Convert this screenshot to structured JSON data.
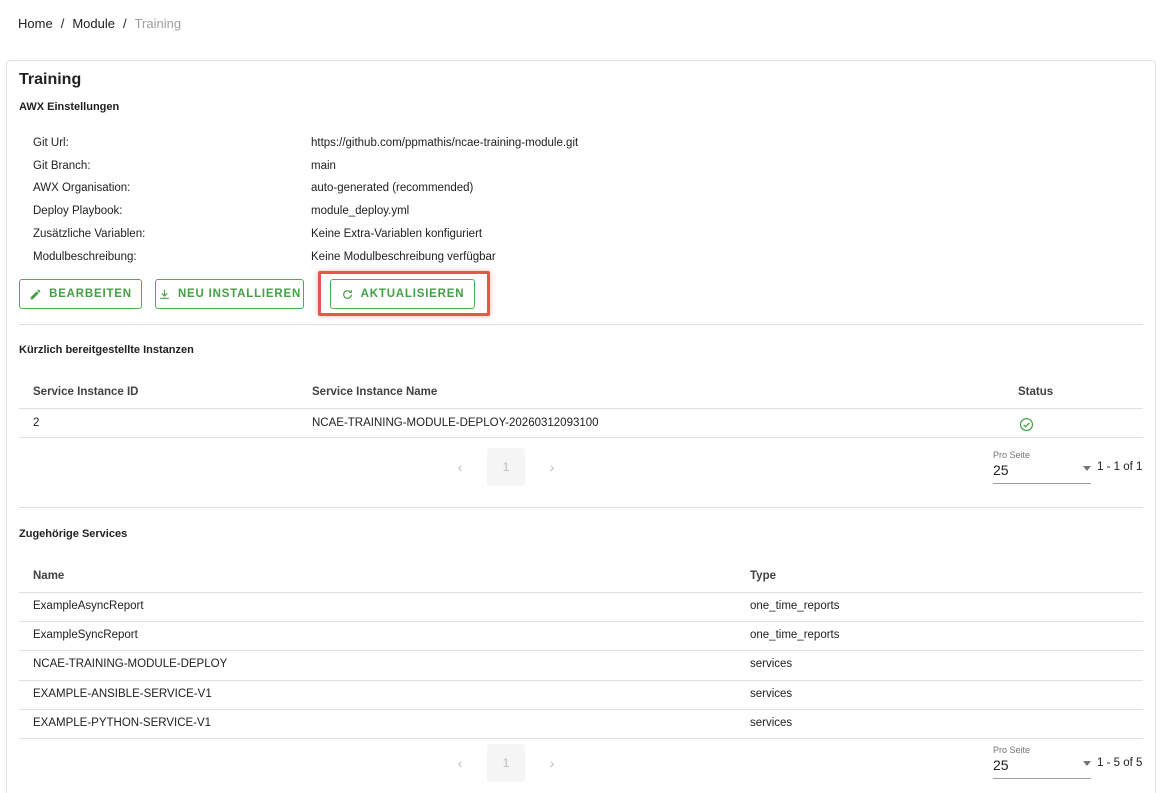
{
  "breadcrumb": {
    "home": "Home",
    "sep1": "/",
    "module": "Module",
    "sep2": "/",
    "current": "Training"
  },
  "page": {
    "title": "Training",
    "subtitle": "AWX Einstellungen"
  },
  "settings": [
    {
      "label": "Git Url:",
      "value": "https://github.com/ppmathis/ncae-training-module.git"
    },
    {
      "label": "Git Branch:",
      "value": "main"
    },
    {
      "label": "AWX Organisation:",
      "value": "auto-generated (recommended)"
    },
    {
      "label": "Deploy Playbook:",
      "value": "module_deploy.yml"
    },
    {
      "label": "Zusätzliche Variablen:",
      "value": "Keine Extra-Variablen konfiguriert"
    },
    {
      "label": "Modulbeschreibung:",
      "value": "Keine Modulbeschreibung verfügbar"
    }
  ],
  "buttons": {
    "edit": "BEARBEITEN",
    "reinstall": "NEU INSTALLIEREN",
    "update": "AKTUALISIEREN"
  },
  "instances": {
    "title": "Kürzlich bereitgestellte Instanzen",
    "headers": {
      "id": "Service Instance ID",
      "name": "Service Instance Name",
      "status": "Status"
    },
    "rows": [
      {
        "id": "2",
        "name": "NCAE-TRAINING-MODULE-DEPLOY-20260312093100",
        "status": "success"
      }
    ],
    "pagination": {
      "page": "1",
      "per_page_label": "Pro Seite",
      "per_page": "25",
      "range": "1 - 1 of 1"
    }
  },
  "services": {
    "title": "Zugehörige Services",
    "headers": {
      "name": "Name",
      "type": "Type"
    },
    "rows": [
      {
        "name": "ExampleAsyncReport",
        "type": "one_time_reports"
      },
      {
        "name": "ExampleSyncReport",
        "type": "one_time_reports"
      },
      {
        "name": "NCAE-TRAINING-MODULE-DEPLOY",
        "type": "services"
      },
      {
        "name": "EXAMPLE-ANSIBLE-SERVICE-V1",
        "type": "services"
      },
      {
        "name": "EXAMPLE-PYTHON-SERVICE-V1",
        "type": "services"
      }
    ],
    "pagination": {
      "page": "1",
      "per_page_label": "Pro Seite",
      "per_page": "25",
      "range": "1 - 5 of 5"
    }
  },
  "colors": {
    "accent": "#43a047",
    "highlight": "#e5564b"
  }
}
